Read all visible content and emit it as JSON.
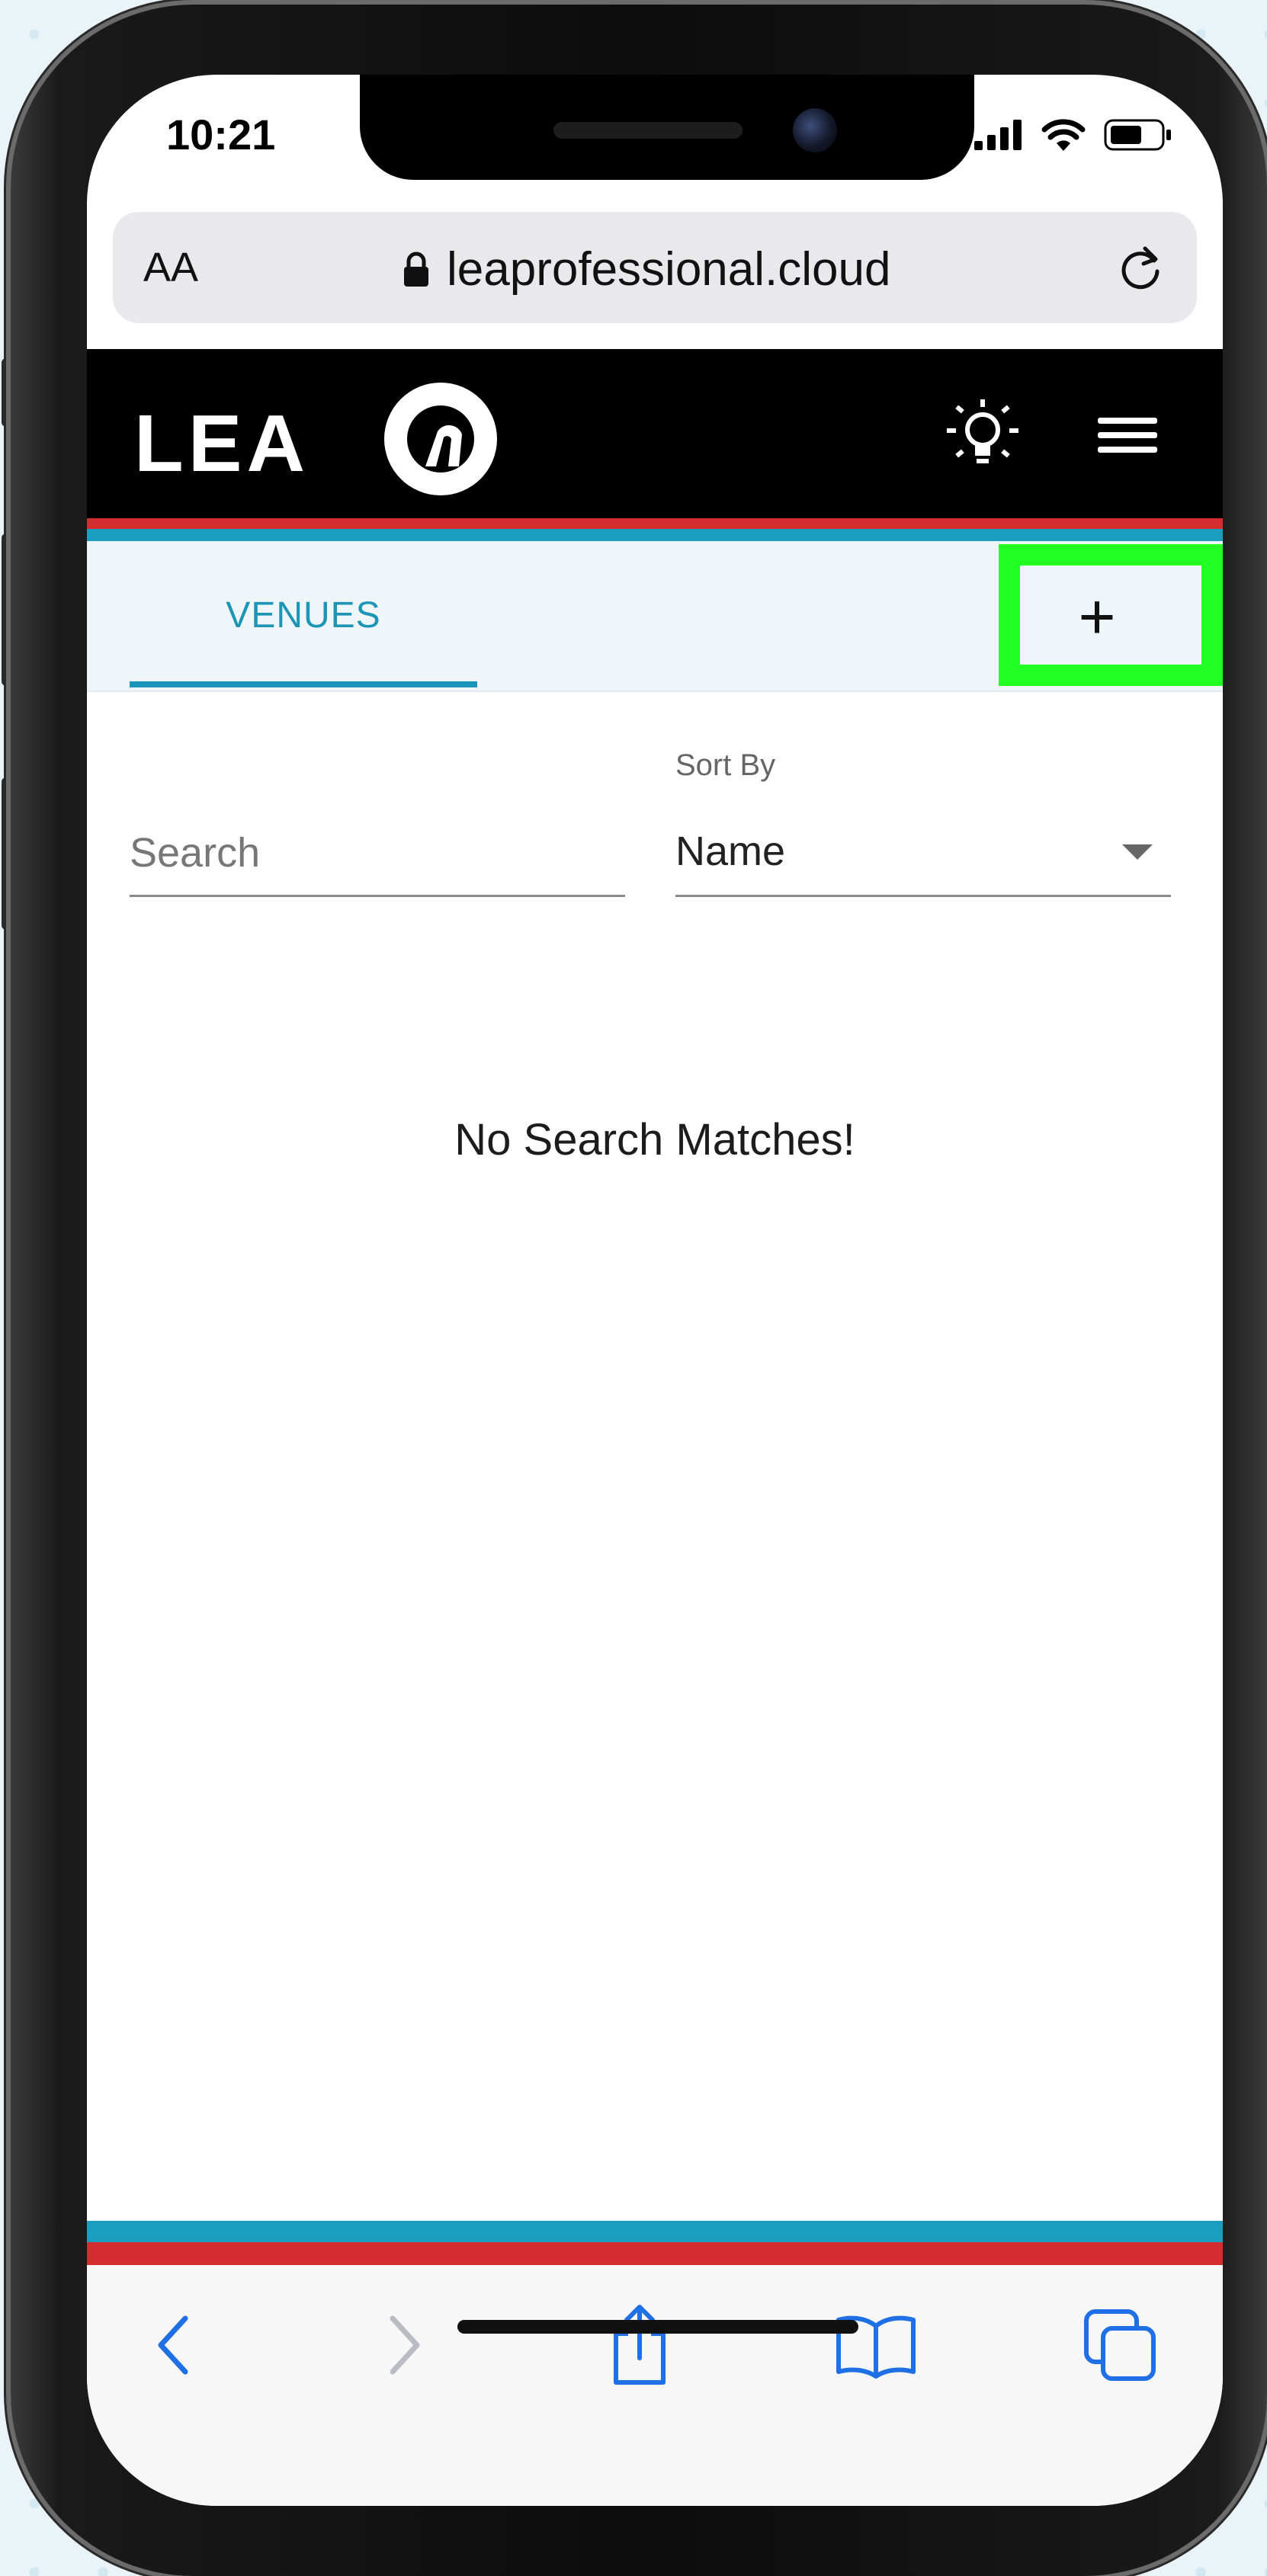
{
  "status_bar": {
    "time": "10:21"
  },
  "browser": {
    "text_size_label": "AA",
    "url": "leaprofessional.cloud"
  },
  "site": {
    "logo_text": "LEA"
  },
  "tabs": [
    {
      "label": "VENUES",
      "active": true
    }
  ],
  "add_button": {
    "label": "+"
  },
  "search": {
    "placeholder": "Search",
    "value": ""
  },
  "sort": {
    "label": "Sort By",
    "selected": "Name"
  },
  "empty_state": {
    "message": "No Search Matches!"
  },
  "colors": {
    "accent_blue": "#1a9ec0",
    "accent_red": "#d42c2f",
    "highlight_green": "#22ff22",
    "ios_blue": "#1f6fe5"
  }
}
